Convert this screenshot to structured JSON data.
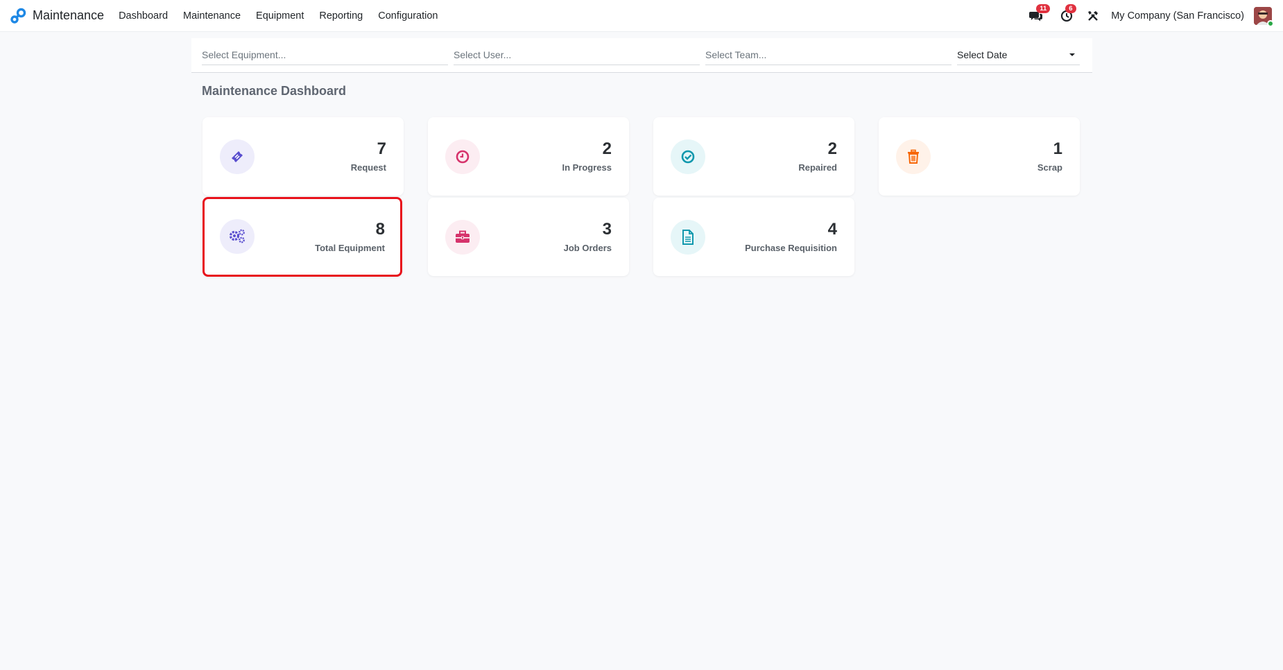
{
  "app": {
    "title": "Maintenance",
    "menu": [
      "Dashboard",
      "Maintenance",
      "Equipment",
      "Reporting",
      "Configuration"
    ]
  },
  "systray": {
    "messages_count": "11",
    "activities_count": "6",
    "company": "My Company (San Francisco)"
  },
  "filters": {
    "equipment_placeholder": "Select Equipment...",
    "user_placeholder": "Select User...",
    "team_placeholder": "Select Team...",
    "date_label": "Select Date"
  },
  "dashboard": {
    "title": "Maintenance Dashboard",
    "cards": [
      {
        "value": "7",
        "label": "Request",
        "icon": "ticket-icon",
        "color": "#5a4fcf",
        "bg": "#eeedfb"
      },
      {
        "value": "2",
        "label": "In Progress",
        "icon": "clock-icon",
        "color": "#d6336c",
        "bg": "#fcedf2"
      },
      {
        "value": "2",
        "label": "Repaired",
        "icon": "check-circle-icon",
        "color": "#1098ad",
        "bg": "#e6f6f8"
      },
      {
        "value": "1",
        "label": "Scrap",
        "icon": "trash-icon",
        "color": "#f76707",
        "bg": "#fff2e9"
      },
      {
        "value": "8",
        "label": "Total Equipment",
        "icon": "gears-icon",
        "color": "#5a4fcf",
        "bg": "#eeedfb"
      },
      {
        "value": "3",
        "label": "Job Orders",
        "icon": "briefcase-icon",
        "color": "#d6336c",
        "bg": "#fcedf2"
      },
      {
        "value": "4",
        "label": "Purchase Requisition",
        "icon": "document-icon",
        "color": "#1098ad",
        "bg": "#e6f6f8"
      }
    ]
  }
}
